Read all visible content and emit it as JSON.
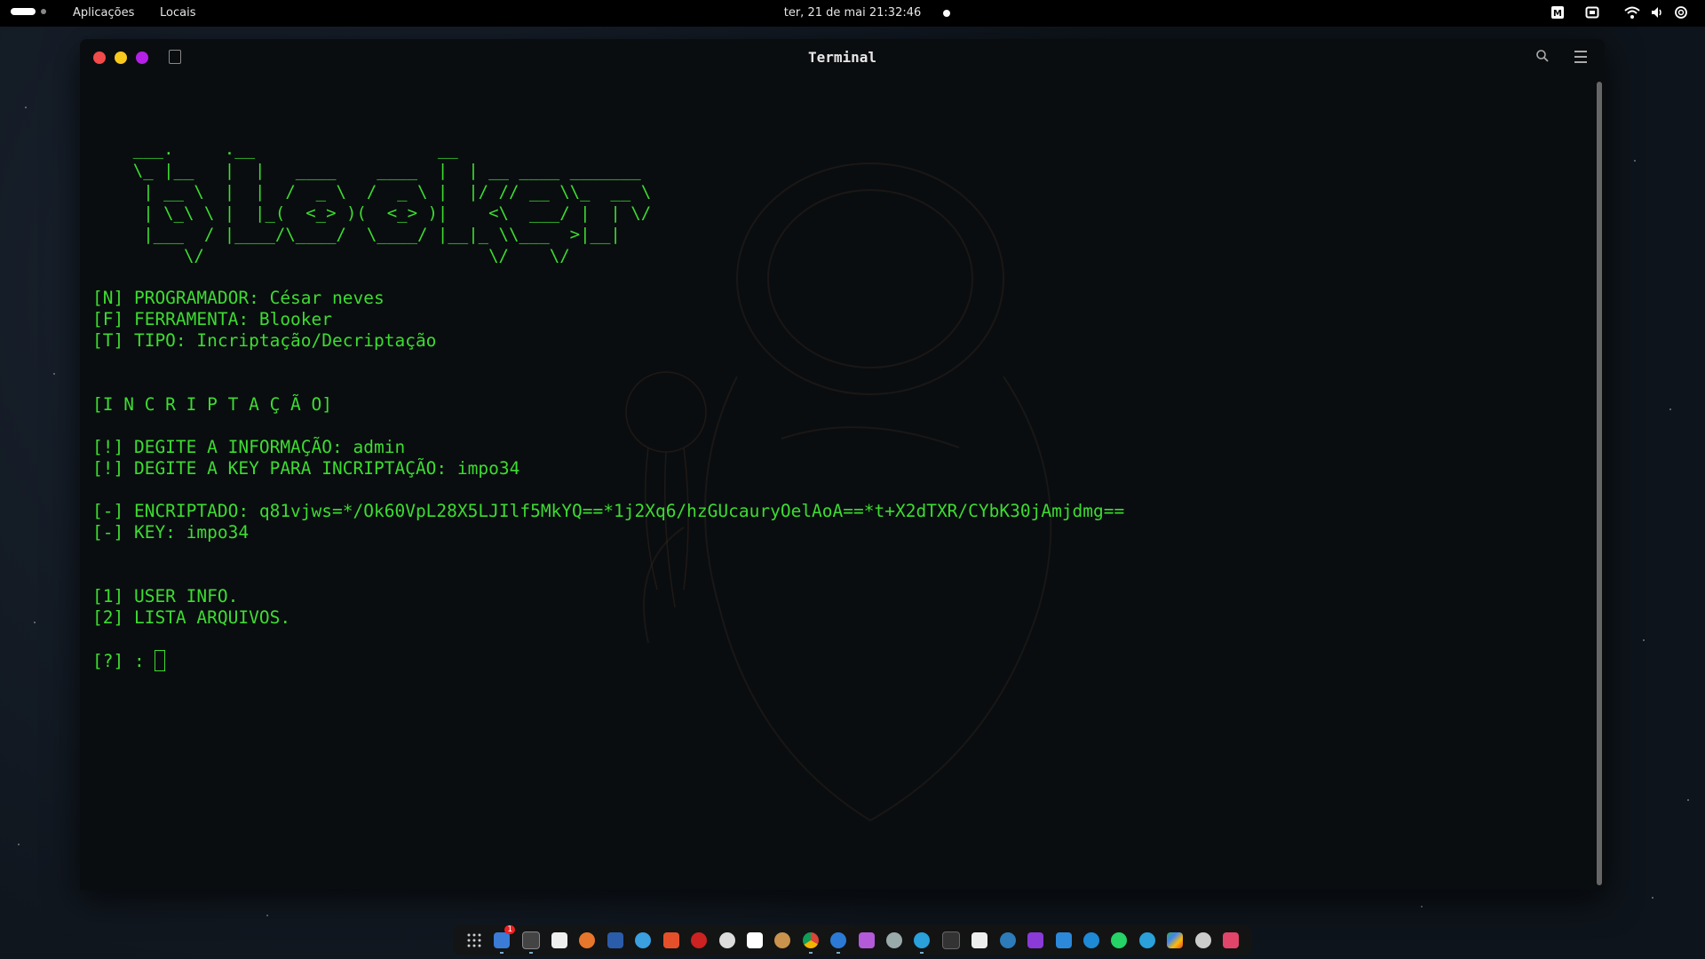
{
  "topbar": {
    "menus": [
      "Aplicações",
      "Locais"
    ],
    "clock": "ter, 21 de mai  21:32:46",
    "tray_icons": [
      "m-app-icon",
      "screenshot-icon",
      "wifi-icon",
      "volume-icon",
      "power-icon"
    ]
  },
  "window": {
    "title": "Terminal"
  },
  "terminal": {
    "ascii_art": [
      "    ___.     .__                  __",
      "    \\_ |__   |  |   ____    ____  |  | __ ____ _______",
      "     | __ \\  |  |  /  _ \\  /  _ \\ |  |/ // __ \\\\_  __ \\",
      "     | \\_\\ \\ |  |_(  <_> )(  <_> )|    <\\  ___/ |  | \\/",
      "     |___  / |____/\\____/  \\____/ |__|_ \\\\___  >|__|",
      "         \\/                            \\/    \\/"
    ],
    "info": [
      "[N] PROGRAMADOR: César neves",
      "[F] FERRAMENTA: Blooker",
      "[T] TIPO: Incriptação/Decriptação"
    ],
    "section_header": "[I N C R I P T A Ç Ã O]",
    "prompts": [
      "[!] DEGITE A INFORMAÇÃO: admin",
      "[!] DEGITE A KEY PARA INCRIPTAÇÃO: impo34"
    ],
    "results": [
      "[-] ENCRIPTADO: q81vjws=*/Ok60VpL28X5LJIlf5MkYQ==*1j2Xq6/hzGUcauryOelAoA==*t+X2dTXR/CYbK30jAmjdmg==",
      "[-] KEY: impo34"
    ],
    "options": [
      "[1] USER INFO.",
      "[2] LISTA ARQUIVOS."
    ],
    "input_prompt": "[?] : "
  },
  "dock": {
    "icons": [
      "apps-grid-icon",
      "mail-icon",
      "terminal-icon",
      "text-editor-icon",
      "firefox-icon",
      "mega-icon",
      "safari-icon",
      "brave-icon",
      "cherry-icon",
      "settings-icon",
      "calendar-icon",
      "cookie-icon",
      "chrome-icon",
      "vscode-icon",
      "notes-icon",
      "chat-icon",
      "telegram-alt-icon",
      "window-icon",
      "photos-icon",
      "vpn-icon",
      "video-editor-icon",
      "store-icon",
      "edge-icon",
      "whatsapp-icon",
      "telegram-icon",
      "play-store-icon",
      "messenger-icon",
      "trash-icon"
    ],
    "badge_count": "1"
  },
  "colors": {
    "terminal_text": "#3ddc31",
    "terminal_bg": "#090d0f"
  }
}
